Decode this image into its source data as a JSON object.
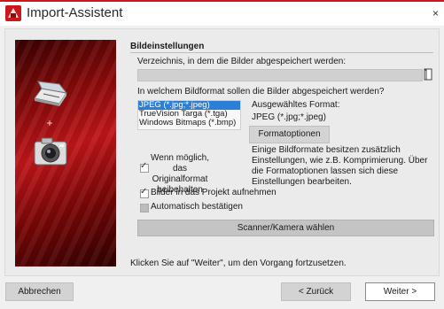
{
  "window": {
    "title": "Import-Assistent",
    "close_glyph": "×",
    "accent_color": "#c8181b"
  },
  "icons": {
    "app": "app-logo-icon",
    "close": "close-icon",
    "scanner": "scanner-icon",
    "plus": "plus-icon",
    "camera": "camera-icon",
    "folder": "folder-browse-icon"
  },
  "section": {
    "heading": "Bildeinstellungen"
  },
  "directory": {
    "label": "Verzeichnis, in dem die Bilder abgespeichert werden:",
    "value": ""
  },
  "format": {
    "question": "In welchem Bildformat sollen die Bilder abgespeichert werden?",
    "options": [
      "JPEG (*.jpg;*.jpeg)",
      "TrueVision Targa (*.tga)",
      "Windows Bitmaps (*.bmp)"
    ],
    "selected_index": 0,
    "selected_label": "Ausgewähltes Format:",
    "selected_value": "JPEG (*.jpg;*.jpeg)",
    "options_button": "Formatoptionen",
    "description": "Einige Bildformate besitzen zusätzlich Einstellungen, wie z.B. Komprimierung. Über die Formatoptionen lassen sich diese Einstellungen bearbeiten."
  },
  "checkboxes": {
    "keep_original": {
      "line1": "Wenn möglich, das",
      "line2": "Originalformat",
      "line3": "beibehalten",
      "checked": true
    },
    "add_to_project": {
      "label": "Bilder in das Projekt aufnehmen",
      "checked": true
    },
    "auto_confirm": {
      "label": "Automatisch bestätigen",
      "checked": false
    }
  },
  "scanner_button": "Scanner/Kamera wählen",
  "footer_note": "Klicken Sie auf \"Weiter\", um den Vorgang fortzusetzen.",
  "buttons": {
    "cancel": "Abbrechen",
    "back": "< Zurück",
    "next": "Weiter >"
  }
}
